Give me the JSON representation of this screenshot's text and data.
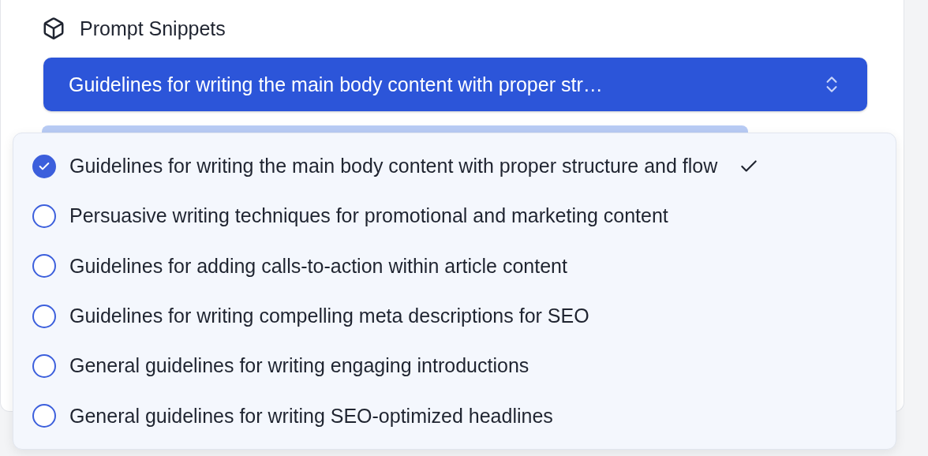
{
  "section": {
    "title": "Prompt Snippets"
  },
  "select": {
    "value": "Guidelines for writing the main body content with proper str…",
    "expanded": true
  },
  "options": [
    {
      "label": "Guidelines for writing the main body content with proper structure and flow",
      "selected": true
    },
    {
      "label": "Persuasive writing techniques for promotional and marketing content",
      "selected": false
    },
    {
      "label": "Guidelines for adding calls-to-action within article content",
      "selected": false
    },
    {
      "label": "Guidelines for writing compelling meta descriptions for SEO",
      "selected": false
    },
    {
      "label": "General guidelines for writing engaging introductions",
      "selected": false
    },
    {
      "label": "General guidelines for writing SEO-optimized headlines",
      "selected": false
    }
  ]
}
